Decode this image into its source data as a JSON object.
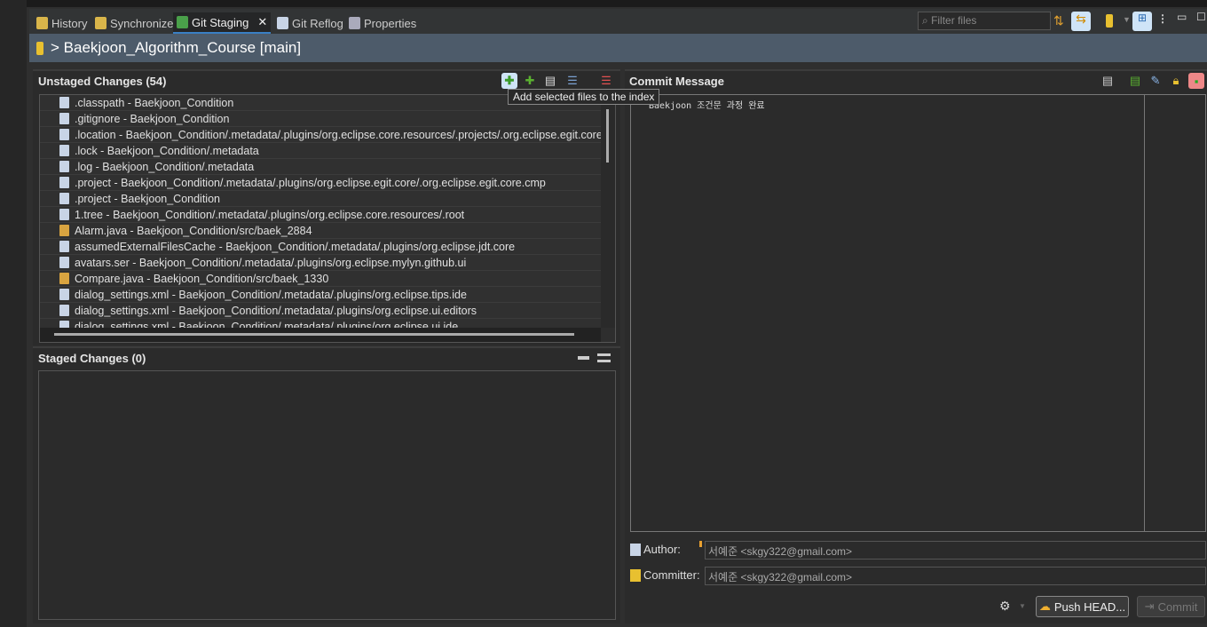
{
  "tabs": [
    {
      "label": "History",
      "icon": "history-icon"
    },
    {
      "label": "Synchronize",
      "icon": "synchronize-icon"
    },
    {
      "label": "Git Staging",
      "icon": "git-staging-icon",
      "active": true
    },
    {
      "label": "Git Reflog",
      "icon": "git-reflog-icon"
    },
    {
      "label": "Properties",
      "icon": "properties-icon"
    }
  ],
  "filter": {
    "placeholder": "Filter files"
  },
  "header": {
    "title": "> Baekjoon_Algorithm_Course [main]"
  },
  "unstaged": {
    "title": "Unstaged Changes (54)",
    "tooltip": "Add selected files to the index",
    "files": [
      {
        "label": ".classpath - Baekjoon_Condition",
        "type": "xml"
      },
      {
        "label": ".gitignore - Baekjoon_Condition",
        "type": "text"
      },
      {
        "label": ".location - Baekjoon_Condition/.metadata/.plugins/org.eclipse.core.resources/.projects/.org.eclipse.egit.core.cmp",
        "type": "text"
      },
      {
        "label": ".lock - Baekjoon_Condition/.metadata",
        "type": "text"
      },
      {
        "label": ".log - Baekjoon_Condition/.metadata",
        "type": "text"
      },
      {
        "label": ".project - Baekjoon_Condition/.metadata/.plugins/org.eclipse.egit.core/.org.eclipse.egit.core.cmp",
        "type": "xml"
      },
      {
        "label": ".project - Baekjoon_Condition",
        "type": "xml"
      },
      {
        "label": "1.tree - Baekjoon_Condition/.metadata/.plugins/org.eclipse.core.resources/.root",
        "type": "text"
      },
      {
        "label": "Alarm.java - Baekjoon_Condition/src/baek_2884",
        "type": "java"
      },
      {
        "label": "assumedExternalFilesCache - Baekjoon_Condition/.metadata/.plugins/org.eclipse.jdt.core",
        "type": "text"
      },
      {
        "label": "avatars.ser - Baekjoon_Condition/.metadata/.plugins/org.eclipse.mylyn.github.ui",
        "type": "text"
      },
      {
        "label": "Compare.java - Baekjoon_Condition/src/baek_1330",
        "type": "java"
      },
      {
        "label": "dialog_settings.xml - Baekjoon_Condition/.metadata/.plugins/org.eclipse.tips.ide",
        "type": "xml"
      },
      {
        "label": "dialog_settings.xml - Baekjoon_Condition/.metadata/.plugins/org.eclipse.ui.editors",
        "type": "xml"
      },
      {
        "label": "dialog_settings.xml - Baekjoon_Condition/.metadata/.plugins/org.eclipse.ui.ide",
        "type": "xml"
      }
    ]
  },
  "staged": {
    "title": "Staged Changes (0)"
  },
  "commit": {
    "title": "Commit Message",
    "message": "Baekjoon 조건문 과정 완료",
    "author_label": "Author:",
    "author": "서예준 <skgy322@gmail.com>",
    "committer_label": "Committer:",
    "committer": "서예준 <skgy322@gmail.com>",
    "push_label": "Push HEAD...",
    "commit_label": "Commit"
  }
}
